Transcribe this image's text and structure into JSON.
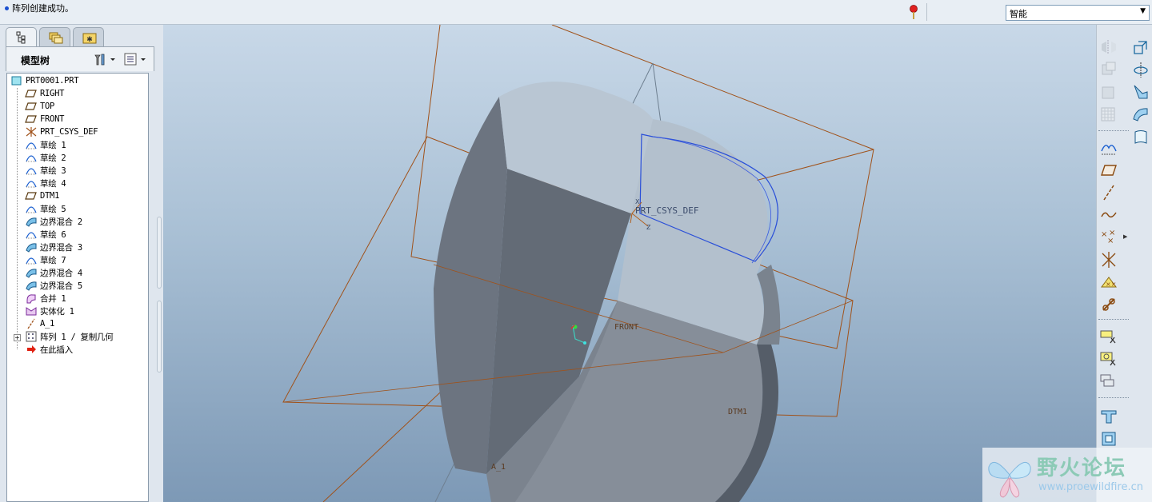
{
  "message_bar": {
    "text": "阵列创建成功。",
    "filter": "智能"
  },
  "left_panel": {
    "tree_title": "模型树",
    "tree": [
      {
        "label": "PRT0001.PRT",
        "icon": "part-icon"
      },
      {
        "label": "RIGHT",
        "icon": "datum-plane-icon"
      },
      {
        "label": "TOP",
        "icon": "datum-plane-icon"
      },
      {
        "label": "FRONT",
        "icon": "datum-plane-icon"
      },
      {
        "label": "PRT_CSYS_DEF",
        "icon": "csys-icon"
      },
      {
        "label": "草绘 1",
        "icon": "sketch-icon"
      },
      {
        "label": "草绘 2",
        "icon": "sketch-icon"
      },
      {
        "label": "草绘 3",
        "icon": "sketch-icon"
      },
      {
        "label": "草绘 4",
        "icon": "sketch-icon"
      },
      {
        "label": "DTM1",
        "icon": "datum-plane-icon"
      },
      {
        "label": "草绘 5",
        "icon": "sketch-icon"
      },
      {
        "label": "边界混合 2",
        "icon": "boundary-blend-icon"
      },
      {
        "label": "草绘 6",
        "icon": "sketch-icon"
      },
      {
        "label": "边界混合 3",
        "icon": "boundary-blend-icon"
      },
      {
        "label": "草绘 7",
        "icon": "sketch-icon"
      },
      {
        "label": "边界混合 4",
        "icon": "boundary-blend-icon"
      },
      {
        "label": "边界混合 5",
        "icon": "boundary-blend-icon"
      },
      {
        "label": "合并 1",
        "icon": "merge-icon"
      },
      {
        "label": "实体化 1",
        "icon": "solidify-icon"
      },
      {
        "label": "A_1",
        "icon": "datum-axis-icon"
      },
      {
        "label": "阵列 1 / 复制几何",
        "icon": "pattern-icon"
      },
      {
        "label": "在此插入",
        "icon": "insert-here-arrow-icon"
      }
    ]
  },
  "viewport": {
    "labels": {
      "csys": "PRT_CSYS_DEF",
      "front": "FRONT",
      "dtm1": "DTM1",
      "axis": "A_1",
      "x": "X",
      "z": "Z"
    }
  },
  "watermark": {
    "title": "野火论坛",
    "url": "www.proewildfire.cn"
  },
  "colors": {
    "datum_plane": "#a0521a",
    "sketch_curve": "#2a4fd8",
    "solid_face": "#b9c6d3",
    "solid_side": "#6c7480"
  }
}
